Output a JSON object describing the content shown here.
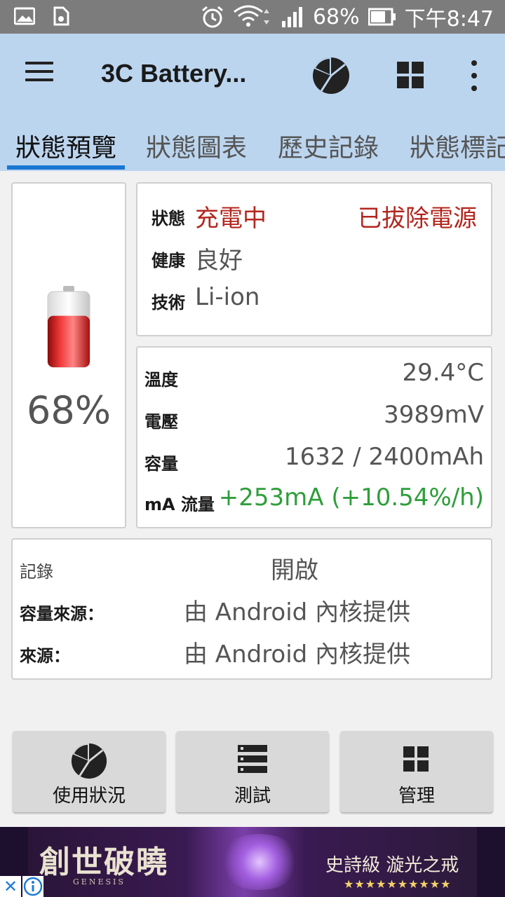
{
  "status_bar": {
    "battery_percent": "68%",
    "time": "下午8:47",
    "icons": [
      "image-icon",
      "sim-icon",
      "alarm-icon",
      "wifi-icon",
      "signal-icon",
      "battery-icon"
    ]
  },
  "app_bar": {
    "title": "3C Battery...",
    "actions": [
      "pie-chart-icon",
      "grid-icon",
      "more-vert-icon"
    ]
  },
  "tabs": [
    {
      "label": "狀態預覽",
      "active": true
    },
    {
      "label": "狀態圖表",
      "active": false
    },
    {
      "label": "歷史記錄",
      "active": false
    },
    {
      "label": "狀態標記",
      "active": false
    }
  ],
  "battery": {
    "percent": "68%",
    "level": 0.68
  },
  "status_card": {
    "status_label": "狀態",
    "status_value": "充電中",
    "plug_value": "已拔除電源",
    "health_label": "健康",
    "health_value": "良好",
    "tech_label": "技術",
    "tech_value": "Li-ion"
  },
  "metrics_card": {
    "temp_label": "溫度",
    "temp_value": "29.4°C",
    "voltage_label": "電壓",
    "voltage_value": "3989mV",
    "capacity_label": "容量",
    "capacity_value": "1632 / 2400mAh",
    "flow_label": "mA 流量",
    "flow_value": "+253mA (+10.54%/h)"
  },
  "record_card": {
    "record_label": "記錄",
    "record_value": "開啟",
    "cap_source_label": "容量來源：",
    "cap_source_value": "由 Android 內核提供",
    "source_label": "來源：",
    "source_value": "由 Android 內核提供"
  },
  "buttons": {
    "usage": "使用狀況",
    "test": "測試",
    "manage": "管理"
  },
  "ad": {
    "title": "創世破曉",
    "subtitle": "GENESIS",
    "tagline": "史詩級 漩光之戒",
    "stars": "★★★★★★★★★★"
  },
  "colors": {
    "app_bar": "#bcd5ef",
    "tab_indicator": "#1976d2",
    "status_red": "#b3261e",
    "flow_green": "#2e9e3a"
  }
}
